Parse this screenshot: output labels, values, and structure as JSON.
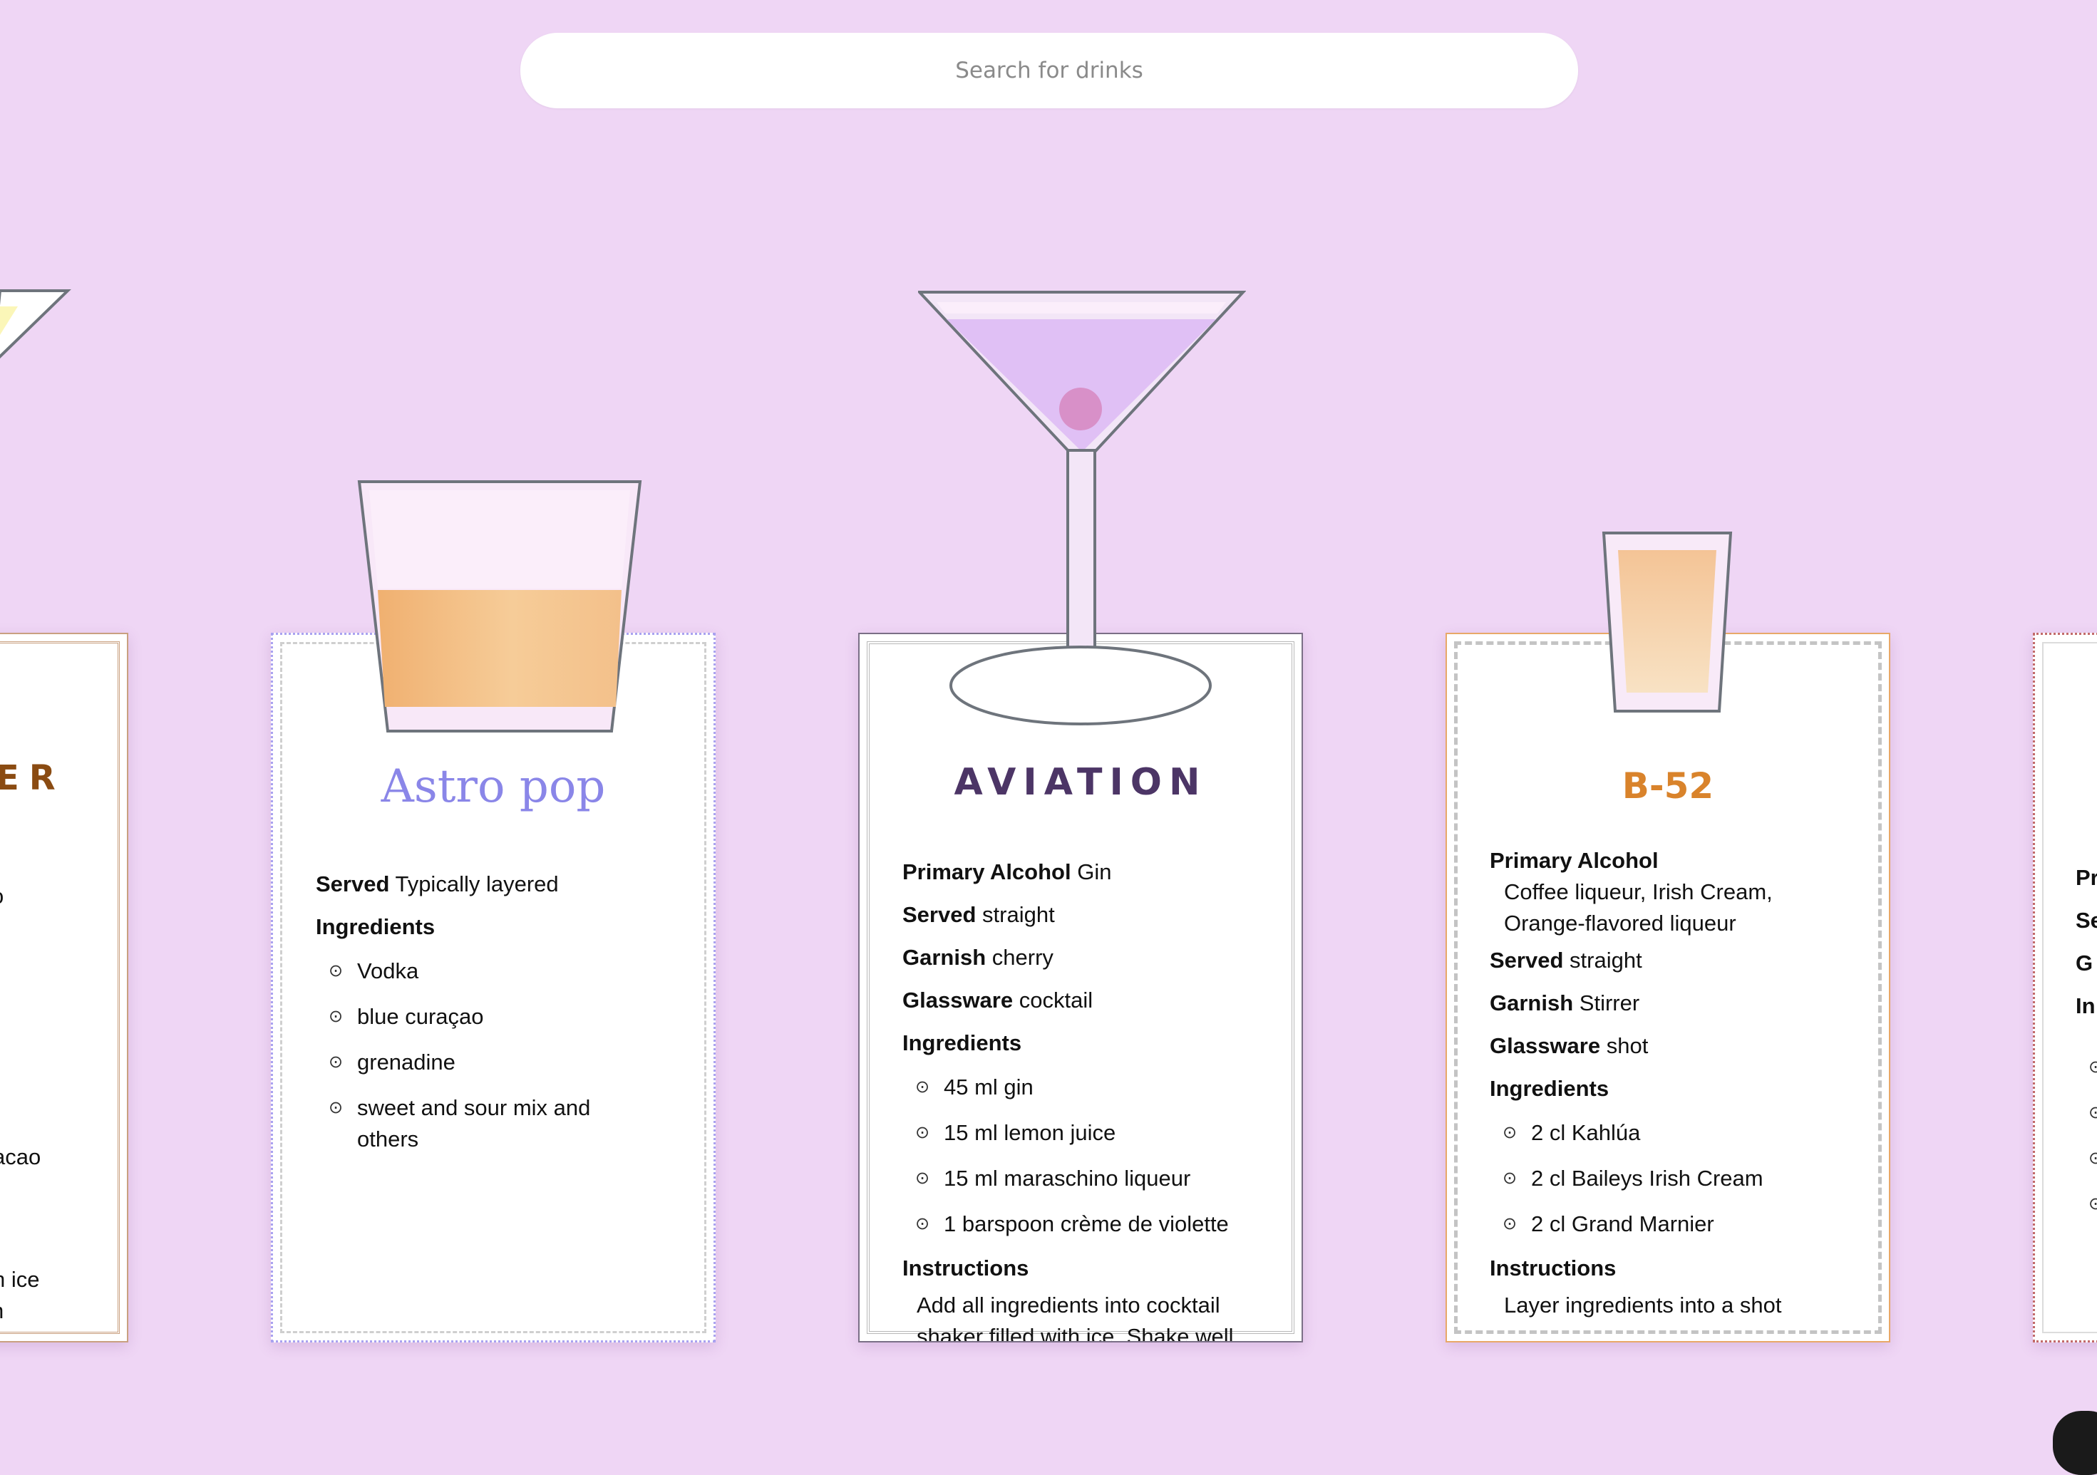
{
  "search": {
    "placeholder": "Search for drinks"
  },
  "cards": [
    {
      "name": "Cutoff left card",
      "title": "ER",
      "title_color": "#8a4b12",
      "fragments": [
        "o",
        "acao",
        "h ice",
        "n"
      ]
    },
    {
      "title": "Astro pop",
      "title_color": "#8a86e8",
      "served_label": "Served",
      "served": "Typically layered",
      "ingredients_label": "Ingredients",
      "ingredients": [
        "Vodka",
        "blue curaçao",
        "grenadine",
        "sweet and sour mix and others"
      ]
    },
    {
      "title": "AVIATION",
      "title_color": "#4c3566",
      "primary_alcohol_label": "Primary Alcohol",
      "primary_alcohol": "Gin",
      "served_label": "Served",
      "served": "straight",
      "garnish_label": "Garnish",
      "garnish": "cherry",
      "glassware_label": "Glassware",
      "glassware": "cocktail",
      "ingredients_label": "Ingredients",
      "ingredients": [
        "45 ml gin",
        "15 ml lemon juice",
        "15 ml maraschino liqueur",
        "1 barspoon crème de violette"
      ],
      "instructions_label": "Instructions",
      "instructions": "Add all ingredients into cocktail shaker filled with ice. Shake well"
    },
    {
      "title": "B-52",
      "title_color": "#d9832b",
      "primary_alcohol_label": "Primary Alcohol",
      "primary_alcohol": "Coffee liqueur, Irish Cream, Orange-flavored liqueur",
      "served_label": "Served",
      "served": "straight",
      "garnish_label": "Garnish",
      "garnish": "Stirrer",
      "glassware_label": "Glassware",
      "glassware": "shot",
      "ingredients_label": "Ingredients",
      "ingredients": [
        "2 cl Kahlúa",
        "2 cl Baileys Irish Cream",
        "2 cl Grand Marnier"
      ],
      "instructions_label": "Instructions",
      "instructions": "Layer ingredients into a shot"
    },
    {
      "name": "Cutoff right card",
      "fragments": [
        "Pr",
        "Se",
        "G",
        "In"
      ]
    }
  ],
  "icons": {
    "bullet": "⊙"
  },
  "colors": {
    "background": "#efd6f5",
    "aviation_liquid": "#e0c0f5",
    "cherry": "#d890c8",
    "astro_liquid": "#f3c08a",
    "b52_liquid": "#f6d2aa",
    "glass_outline": "#6e747c"
  }
}
